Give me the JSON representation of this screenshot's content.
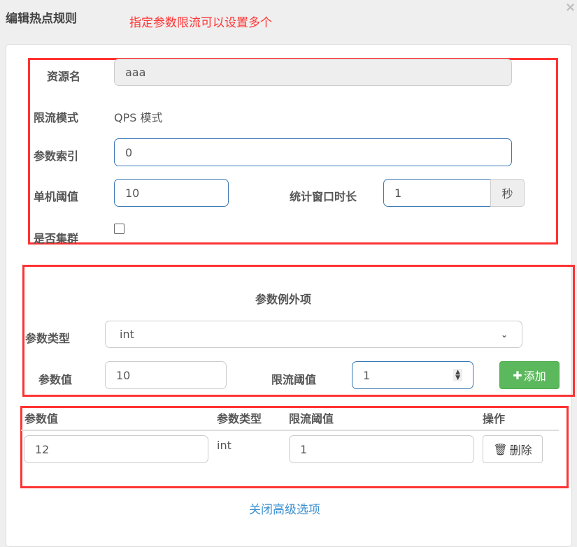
{
  "dialog": {
    "title": "编辑热点规则",
    "annotation": "指定参数限流可以设置多个",
    "close": "×"
  },
  "form": {
    "resource_label": "资源名",
    "resource_value": "aaa",
    "mode_label": "限流模式",
    "mode_value": "QPS 模式",
    "param_index_label": "参数索引",
    "param_index_value": "0",
    "threshold_label": "单机阈值",
    "threshold_value": "10",
    "window_label": "统计窗口时长",
    "window_value": "1",
    "window_unit": "秒",
    "cluster_label": "是否集群",
    "cluster_checked": false
  },
  "exception": {
    "heading": "参数例外项",
    "type_label": "参数类型",
    "type_value": "int",
    "value_label": "参数值",
    "value_value": "10",
    "limit_label": "限流阈值",
    "limit_value": "1",
    "add_button": "添加"
  },
  "table": {
    "headers": [
      "参数值",
      "参数类型",
      "限流阈值",
      "操作"
    ],
    "rows": [
      {
        "value": "12",
        "type": "int",
        "limit": "1",
        "action": "删除"
      }
    ]
  },
  "footer_link": "关闭高级选项",
  "colors": {
    "annotation": "#ff3333",
    "add_button": "#5cb85c",
    "link": "#3a8fd0"
  }
}
